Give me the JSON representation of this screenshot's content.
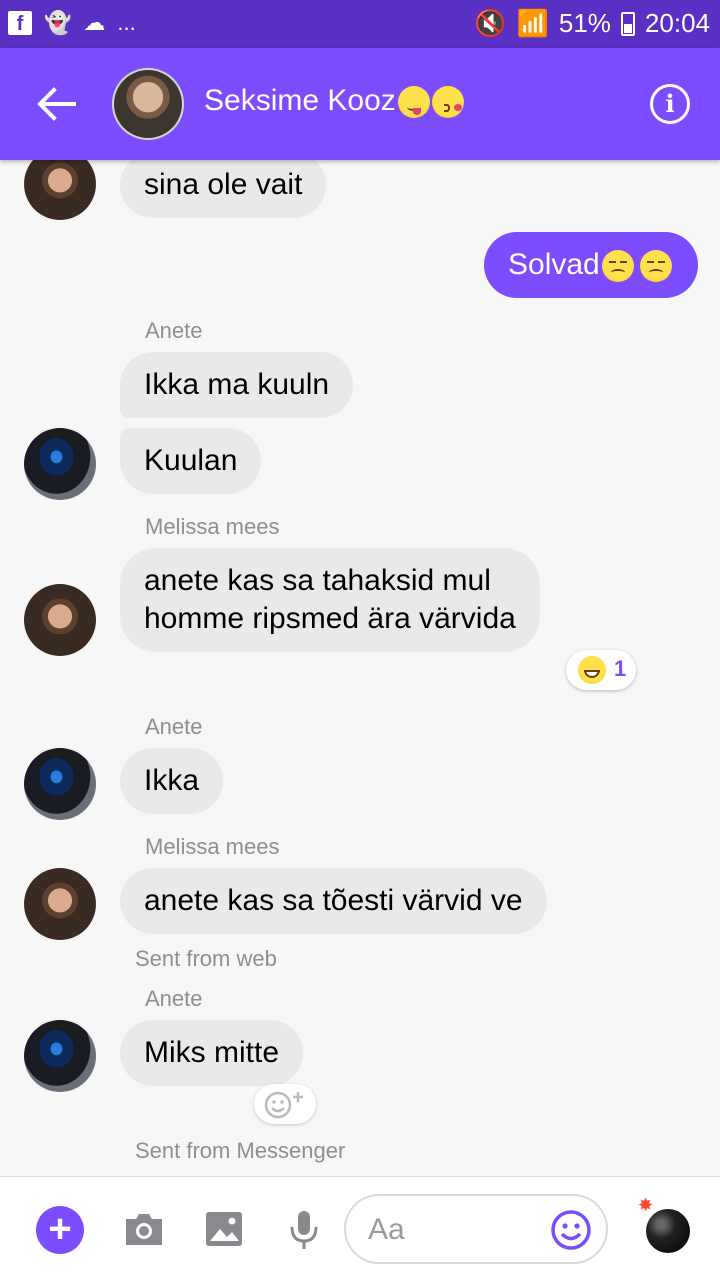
{
  "status_bar": {
    "battery": "51%",
    "time": "20:04",
    "more": "..."
  },
  "header": {
    "title": "Seksime Kooz",
    "title_emojis": [
      "yum-emoji",
      "kiss-emoji"
    ]
  },
  "messages": [
    {
      "type": "in",
      "text": "sina ole vait"
    },
    {
      "type": "out",
      "text": "Solvad",
      "emojis": [
        "disappointed-emoji",
        "disappointed-emoji"
      ]
    },
    {
      "type": "sender",
      "text": "Anete"
    },
    {
      "type": "in",
      "text": "Ikka ma kuuln"
    },
    {
      "type": "in",
      "text": "Kuulan"
    },
    {
      "type": "sender",
      "text": "Melissa mees"
    },
    {
      "type": "in",
      "text_line1": "anete kas sa tahaksid mul",
      "text_line2": "homme ripsmed ära värvida",
      "reaction_count": "1"
    },
    {
      "type": "sender",
      "text": "Anete"
    },
    {
      "type": "in",
      "text": "Ikka"
    },
    {
      "type": "sender",
      "text": "Melissa mees"
    },
    {
      "type": "in",
      "text": "anete kas sa tõesti värvid ve"
    },
    {
      "type": "info",
      "text": "Sent from web"
    },
    {
      "type": "sender",
      "text": "Anete"
    },
    {
      "type": "in",
      "text": "Miks mitte"
    },
    {
      "type": "info",
      "text": "Sent from Messenger"
    }
  ],
  "composer": {
    "placeholder": "Aa"
  },
  "colors": {
    "accent": "#7c4dff",
    "status_bar": "#5a2fc4",
    "bubble_in": "#e9e9eb",
    "meta_text": "#8e8e93"
  }
}
